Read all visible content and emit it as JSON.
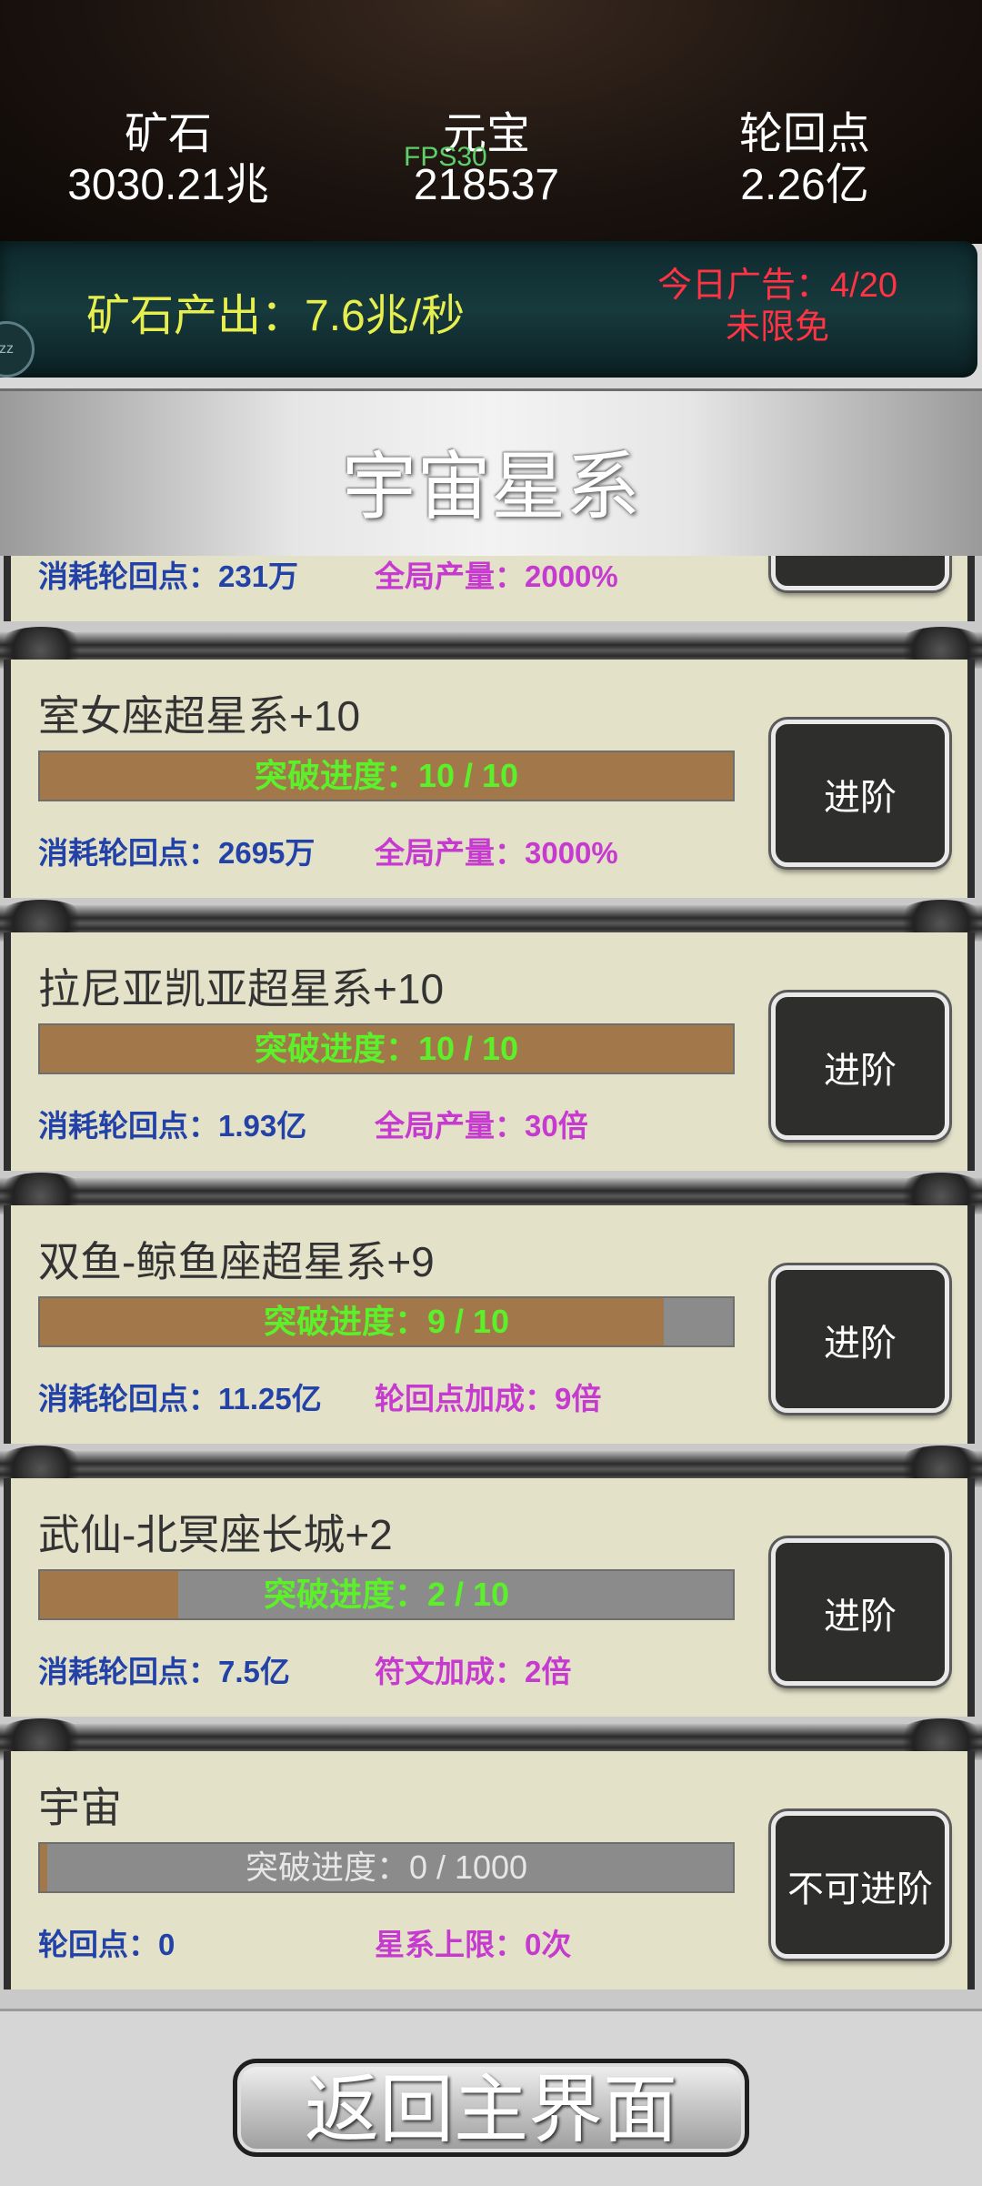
{
  "resources": {
    "ore": {
      "label": "矿石",
      "value": "3030.21兆"
    },
    "yuanbao": {
      "label": "元宝",
      "value": "218537"
    },
    "reincarnation": {
      "label": "轮回点",
      "value": "2.26亿"
    }
  },
  "fps": "FPS30",
  "production": "矿石产出：7.6兆/秒",
  "ads": {
    "line1": "今日广告：4/20",
    "line2": "未限免"
  },
  "zz_icon": "zz",
  "panel_title": "宇宙星系",
  "partial_row": {
    "cost": "消耗轮回点：231万",
    "bonus": "全局产量：2000%"
  },
  "cards": [
    {
      "name": "室女座超星系+10",
      "progress_text": "突破进度：10 / 10",
      "progress": 1.0,
      "cost": "消耗轮回点：2695万",
      "bonus": "全局产量：3000%",
      "button": "进阶"
    },
    {
      "name": "拉尼亚凯亚超星系+10",
      "progress_text": "突破进度：10 / 10",
      "progress": 1.0,
      "cost": "消耗轮回点：1.93亿",
      "bonus": "全局产量：30倍",
      "button": "进阶"
    },
    {
      "name": "双鱼-鲸鱼座超星系+9",
      "progress_text": "突破进度：9 / 10",
      "progress": 0.9,
      "cost": "消耗轮回点：11.25亿",
      "bonus": "轮回点加成：9倍",
      "button": "进阶"
    },
    {
      "name": "武仙-北冥座长城+2",
      "progress_text": "突破进度：2 / 10",
      "progress": 0.2,
      "cost": "消耗轮回点：7.5亿",
      "bonus": "符文加成：2倍",
      "button": "进阶"
    },
    {
      "name": "宇宙",
      "progress_text": "突破进度：0 / 1000",
      "progress": 0.0,
      "cost": "轮回点：0",
      "bonus": "星系上限：0次",
      "button": "不可进阶"
    }
  ],
  "back_button": "返回主界面"
}
